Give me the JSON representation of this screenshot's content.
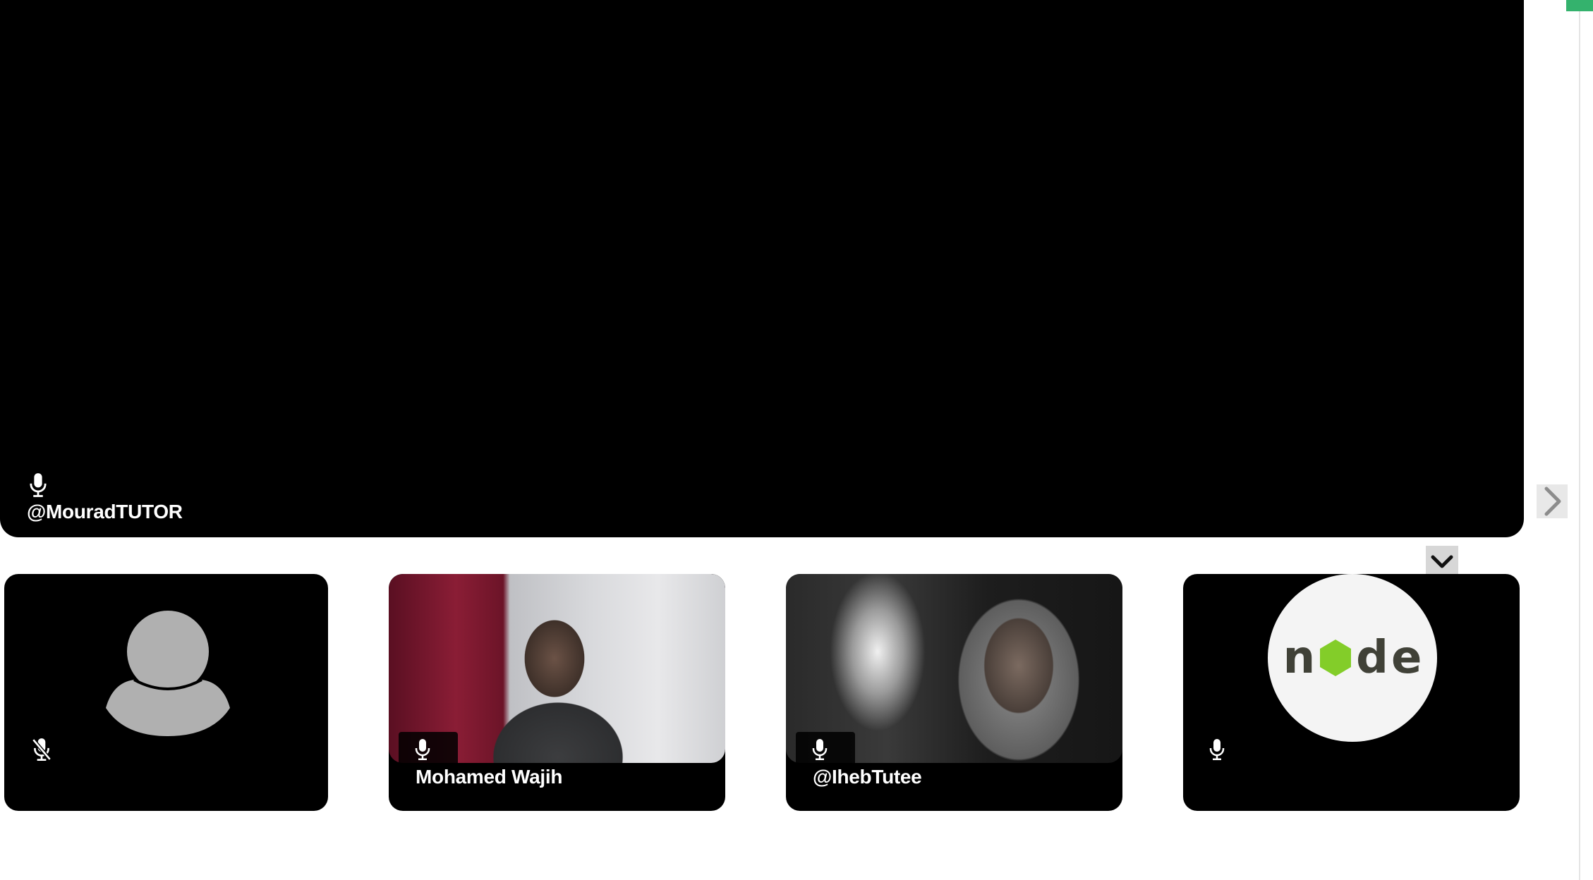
{
  "main_speaker": {
    "name": "@MouradTUTOR",
    "mic_icon": "microphone-icon"
  },
  "controls": {
    "next_icon": "chevron-right-icon",
    "collapse_icon": "chevron-down-icon",
    "accent_color": "#34b26d"
  },
  "participants": [
    {
      "name": "",
      "mic_icon": "microphone-muted-icon",
      "video": "avatar-placeholder"
    },
    {
      "name": "Mohamed Wajih",
      "mic_icon": "microphone-icon",
      "video": "camera-feed"
    },
    {
      "name": "@IhebTutee",
      "mic_icon": "microphone-icon",
      "video": "camera-feed"
    },
    {
      "name": "",
      "mic_icon": "microphone-icon",
      "video": "node-logo",
      "logo_text": [
        "n",
        "d",
        "e"
      ],
      "logo_color": "#404137",
      "logo_accent": "#83cd29"
    }
  ]
}
